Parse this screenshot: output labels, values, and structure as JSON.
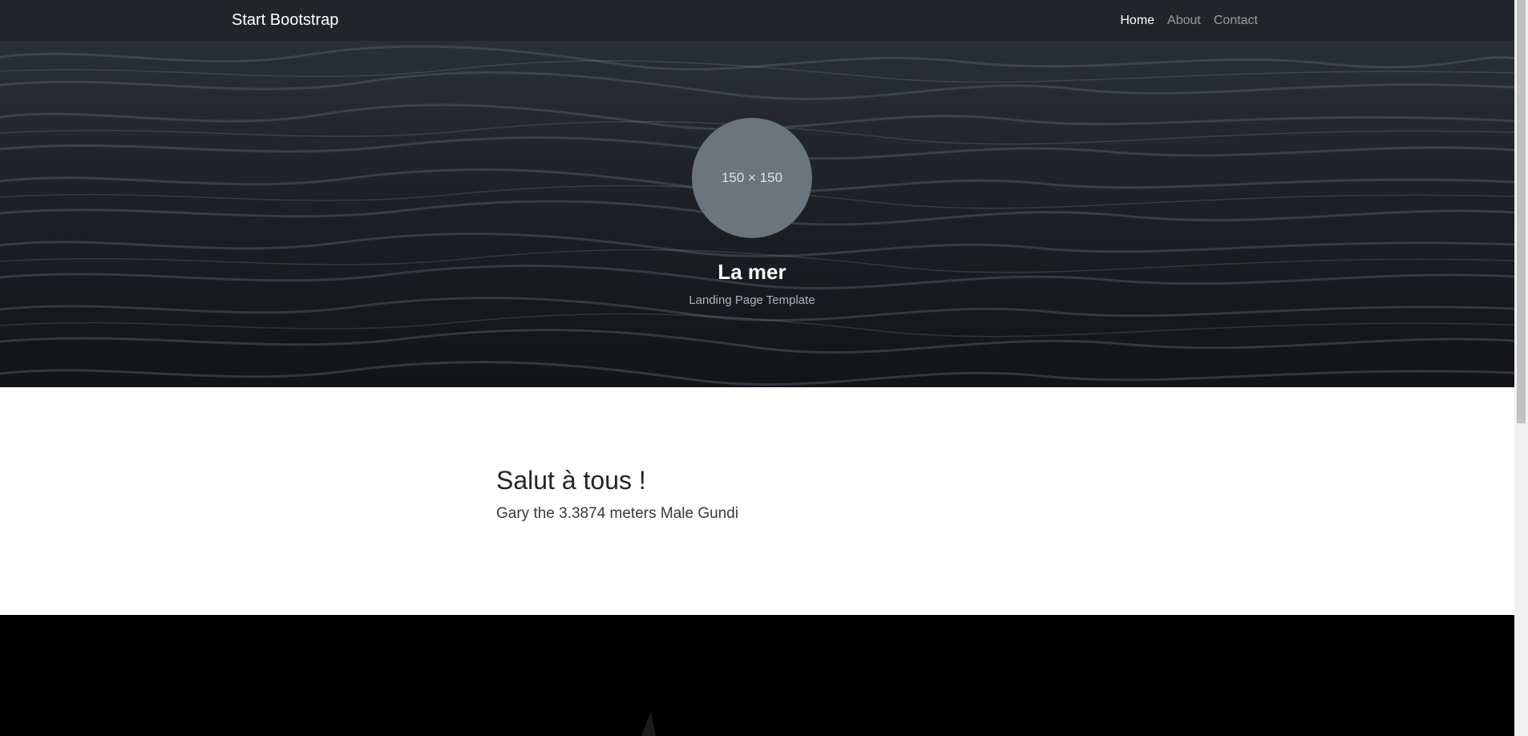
{
  "navbar": {
    "brand": "Start Bootstrap",
    "links": [
      {
        "label": "Home",
        "active": true
      },
      {
        "label": "About",
        "active": false
      },
      {
        "label": "Contact",
        "active": false
      }
    ]
  },
  "hero": {
    "avatar_placeholder": "150 × 150",
    "title": "La mer",
    "subtitle": "Landing Page Template"
  },
  "content": {
    "heading": "Salut à tous !",
    "text": "Gary the 3.3874 meters Male Gundi"
  },
  "colors": {
    "navbar_bg": "#212529",
    "avatar_bg": "#6c757d",
    "dark_section_bg": "#000000"
  }
}
